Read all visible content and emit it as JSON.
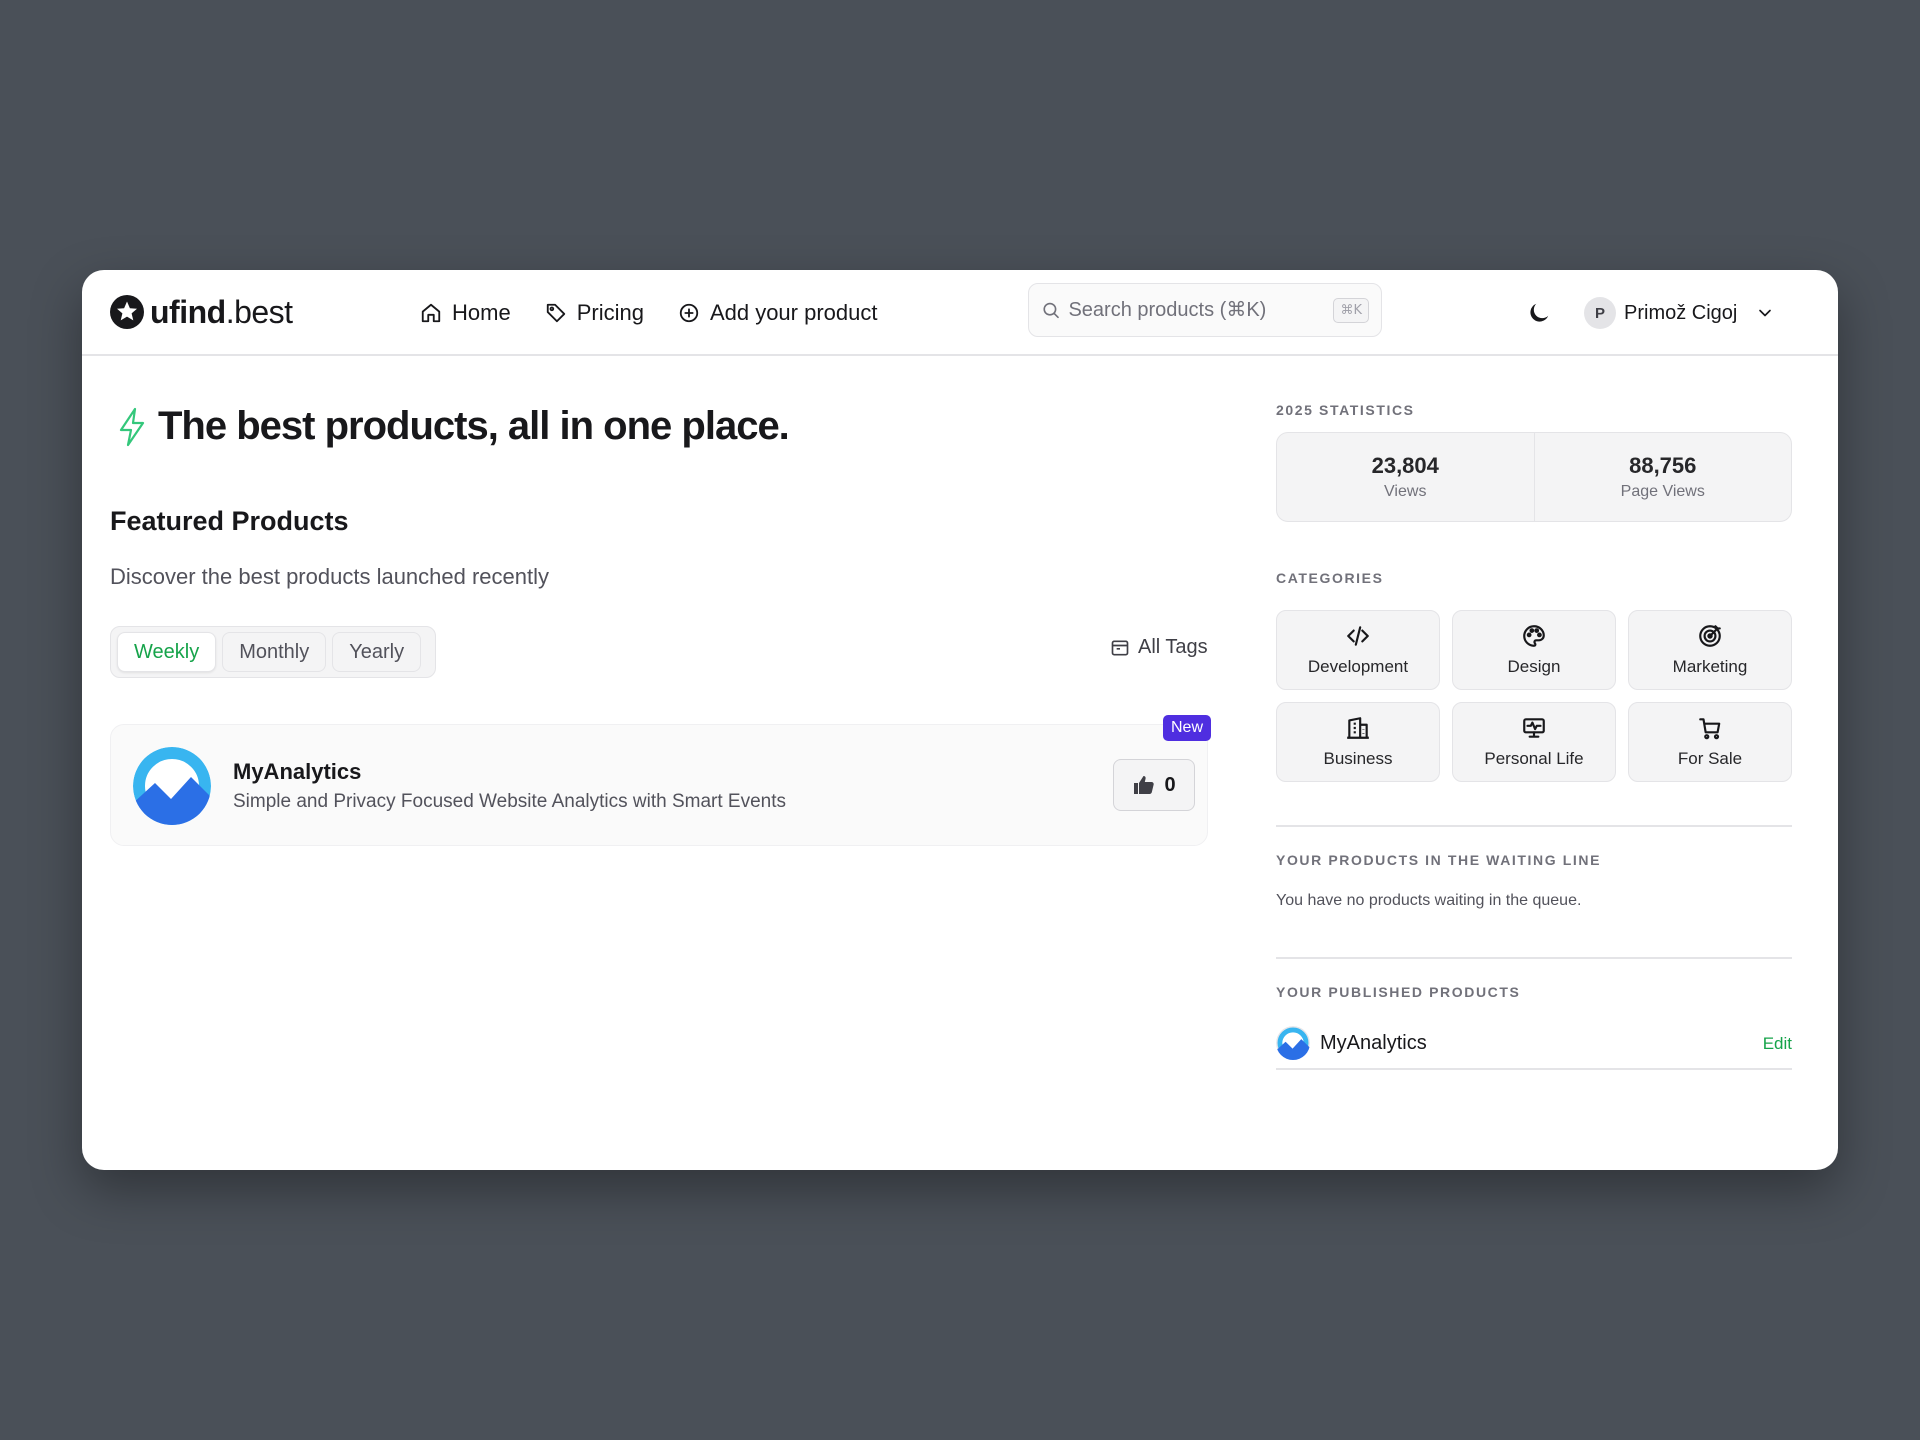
{
  "header": {
    "logo_bold": "ufind",
    "logo_rest": ".best",
    "nav": [
      {
        "label": "Home",
        "icon": "home-icon"
      },
      {
        "label": "Pricing",
        "icon": "tag-icon"
      },
      {
        "label": "Add your product",
        "icon": "plus-circle-icon"
      }
    ],
    "search_placeholder": "Search products (⌘K)",
    "search_shortcut": "⌘K",
    "user": {
      "initial": "P",
      "name": "Primož Cigoj"
    }
  },
  "main": {
    "hero_title": "The best products, all in one place.",
    "section_title": "Featured Products",
    "section_subtitle": "Discover the best products launched recently",
    "tabs": [
      {
        "label": "Weekly",
        "active": true
      },
      {
        "label": "Monthly",
        "active": false
      },
      {
        "label": "Yearly",
        "active": false
      }
    ],
    "all_tags_label": "All Tags",
    "products": [
      {
        "name": "MyAnalytics",
        "description": "Simple and Privacy Focused Website Analytics with Smart Events",
        "badge": "New",
        "votes": "0"
      }
    ]
  },
  "sidebar": {
    "stats_label": "2025 STATISTICS",
    "stats": [
      {
        "value": "23,804",
        "label": "Views"
      },
      {
        "value": "88,756",
        "label": "Page Views"
      }
    ],
    "categories_label": "CATEGORIES",
    "categories": [
      {
        "label": "Development",
        "icon": "code-icon"
      },
      {
        "label": "Design",
        "icon": "palette-icon"
      },
      {
        "label": "Marketing",
        "icon": "target-icon"
      },
      {
        "label": "Business",
        "icon": "building-icon"
      },
      {
        "label": "Personal Life",
        "icon": "monitor-icon"
      },
      {
        "label": "For Sale",
        "icon": "cart-icon"
      }
    ],
    "waiting_label": "YOUR PRODUCTS IN THE WAITING LINE",
    "waiting_message": "You have no products waiting in the queue.",
    "published_label": "YOUR PUBLISHED PRODUCTS",
    "published": [
      {
        "name": "MyAnalytics",
        "action": "Edit"
      }
    ]
  },
  "colors": {
    "accent_green": "#16a34a",
    "badge_purple": "#4f2ee0",
    "backdrop": "#4a5058"
  }
}
